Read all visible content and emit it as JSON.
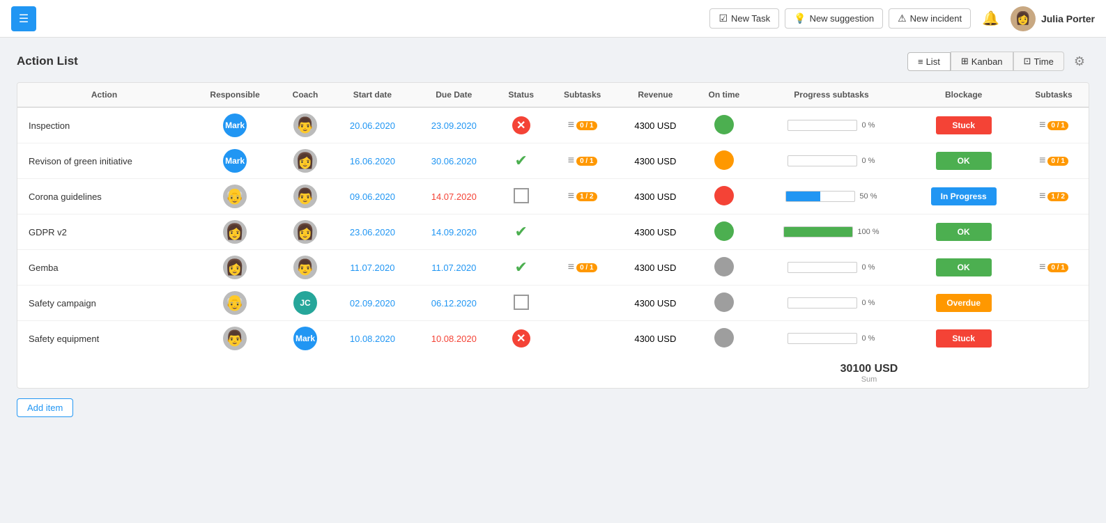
{
  "header": {
    "menu_icon": "☰",
    "buttons": [
      {
        "id": "new-task",
        "icon": "☑",
        "label": "New Task"
      },
      {
        "id": "new-suggestion",
        "icon": "💡",
        "label": "New suggestion"
      },
      {
        "id": "new-incident",
        "icon": "⚠",
        "label": "New incident"
      }
    ],
    "bell_icon": "🔔",
    "user": {
      "name": "Julia Porter",
      "avatar_emoji": "👩"
    }
  },
  "page": {
    "title": "Action List",
    "views": [
      {
        "id": "list",
        "icon": "☰",
        "label": "List",
        "active": true
      },
      {
        "id": "kanban",
        "icon": "⊞",
        "label": "Kanban",
        "active": false
      },
      {
        "id": "time",
        "icon": "⊡",
        "label": "Time",
        "active": false
      }
    ],
    "settings_icon": "⚙"
  },
  "table": {
    "columns": [
      "Action",
      "Responsible",
      "Coach",
      "Start date",
      "Due Date",
      "Status",
      "Subtasks",
      "Revenue",
      "On time",
      "Progress subtasks",
      "Blockage",
      "Subtasks"
    ],
    "rows": [
      {
        "action": "Inspection",
        "responsible": {
          "type": "initial",
          "text": "Mark",
          "color": "blue"
        },
        "coach": {
          "type": "face",
          "emoji": "👨"
        },
        "start_date": "20.06.2020",
        "start_date_color": "blue",
        "due_date": "23.09.2020",
        "due_date_color": "blue",
        "status": "x",
        "subtasks": {
          "count": "0 / 1"
        },
        "revenue": "4300 USD",
        "on_time": "green",
        "progress": 0,
        "progress_type": "none",
        "blockage": "Stuck",
        "blockage_color": "stuck",
        "subtasks2": {
          "count": "0 / 1"
        }
      },
      {
        "action": "Revison of green initiative",
        "responsible": {
          "type": "initial",
          "text": "Mark",
          "color": "blue"
        },
        "coach": {
          "type": "face",
          "emoji": "👩"
        },
        "start_date": "16.06.2020",
        "start_date_color": "blue",
        "due_date": "30.06.2020",
        "due_date_color": "blue",
        "status": "check",
        "subtasks": {
          "count": "0 / 1"
        },
        "revenue": "4300 USD",
        "on_time": "orange",
        "progress": 0,
        "progress_type": "none",
        "blockage": "OK",
        "blockage_color": "ok",
        "subtasks2": {
          "count": "0 / 1"
        }
      },
      {
        "action": "Corona guidelines",
        "responsible": {
          "type": "face",
          "emoji": "👴"
        },
        "coach": {
          "type": "face",
          "emoji": "👨"
        },
        "start_date": "09.06.2020",
        "start_date_color": "blue",
        "due_date": "14.07.2020",
        "due_date_color": "red",
        "status": "empty",
        "subtasks": {
          "count": "1 / 2"
        },
        "revenue": "4300 USD",
        "on_time": "red",
        "progress": 50,
        "progress_type": "blue",
        "blockage": "In Progress",
        "blockage_color": "inprogress",
        "subtasks2": {
          "count": "1 / 2"
        }
      },
      {
        "action": "GDPR v2",
        "responsible": {
          "type": "face",
          "emoji": "👩"
        },
        "coach": {
          "type": "face",
          "emoji": "👩"
        },
        "start_date": "23.06.2020",
        "start_date_color": "blue",
        "due_date": "14.09.2020",
        "due_date_color": "blue",
        "status": "check",
        "subtasks": null,
        "revenue": "4300 USD",
        "on_time": "green",
        "progress": 100,
        "progress_type": "green",
        "blockage": "OK",
        "blockage_color": "ok",
        "subtasks2": null
      },
      {
        "action": "Gemba",
        "responsible": {
          "type": "face",
          "emoji": "👩"
        },
        "coach": {
          "type": "face",
          "emoji": "👨"
        },
        "start_date": "11.07.2020",
        "start_date_color": "blue",
        "due_date": "11.07.2020",
        "due_date_color": "blue",
        "status": "check",
        "subtasks": {
          "count": "0 / 1"
        },
        "revenue": "4300 USD",
        "on_time": "gray",
        "progress": 0,
        "progress_type": "none",
        "blockage": "OK",
        "blockage_color": "ok",
        "subtasks2": {
          "count": "0 / 1"
        }
      },
      {
        "action": "Safety campaign",
        "responsible": {
          "type": "face",
          "emoji": "👴"
        },
        "coach": {
          "type": "initial",
          "text": "JC",
          "color": "teal"
        },
        "start_date": "02.09.2020",
        "start_date_color": "blue",
        "due_date": "06.12.2020",
        "due_date_color": "blue",
        "status": "empty",
        "subtasks": null,
        "revenue": "4300 USD",
        "on_time": "gray",
        "progress": 0,
        "progress_type": "none",
        "blockage": "Overdue",
        "blockage_color": "overdue",
        "subtasks2": null
      },
      {
        "action": "Safety equipment",
        "responsible": {
          "type": "face",
          "emoji": "👨"
        },
        "coach": {
          "type": "initial",
          "text": "Mark",
          "color": "blue"
        },
        "start_date": "10.08.2020",
        "start_date_color": "blue",
        "due_date": "10.08.2020",
        "due_date_color": "red",
        "status": "x",
        "subtasks": null,
        "revenue": "4300 USD",
        "on_time": "gray",
        "progress": 0,
        "progress_type": "none",
        "blockage": "Stuck",
        "blockage_color": "stuck",
        "subtasks2": null
      }
    ],
    "sum": {
      "value": "30100 USD",
      "label": "Sum"
    }
  },
  "add_item_label": "Add item"
}
